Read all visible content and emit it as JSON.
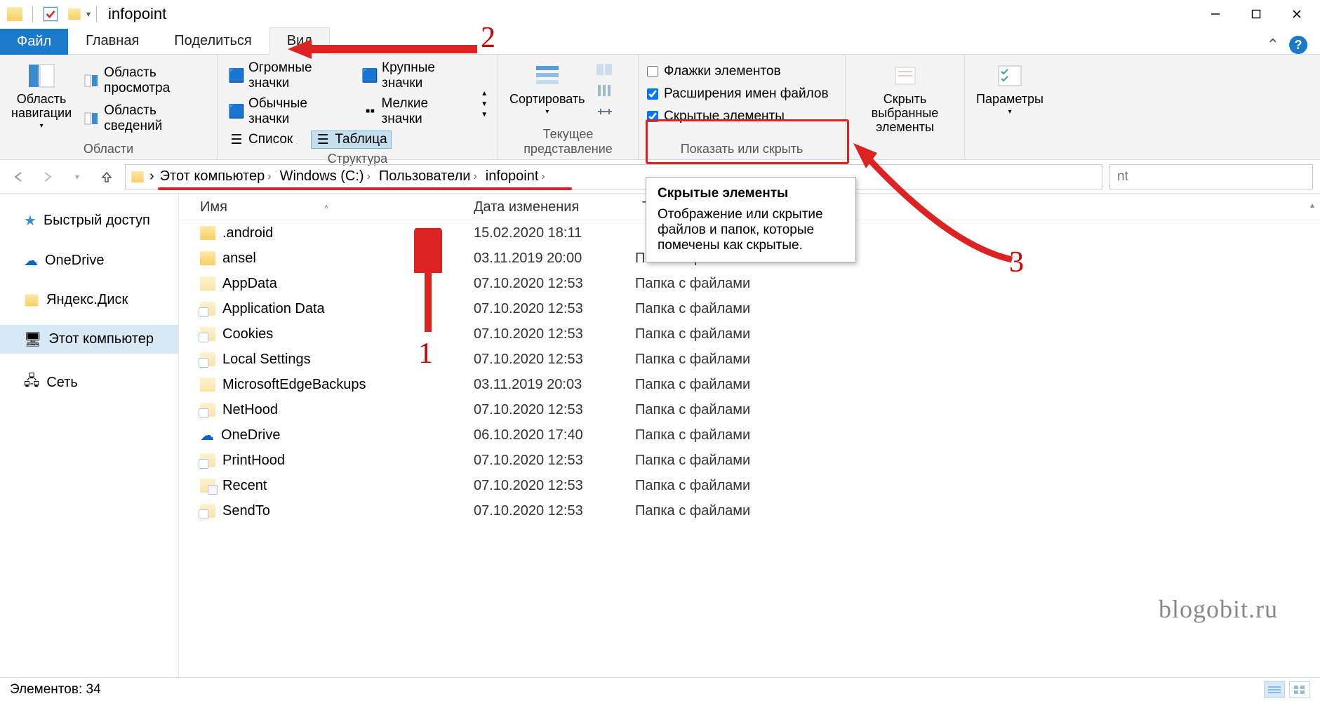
{
  "title": "infopoint",
  "tabs": {
    "file": "Файл",
    "home": "Главная",
    "share": "Поделиться",
    "view": "Вид"
  },
  "ribbon": {
    "panes": {
      "nav_pane": "Область\nнавигации",
      "preview": "Область просмотра",
      "details": "Область сведений",
      "group_panes": "Области"
    },
    "layout": {
      "huge": "Огромные значки",
      "large": "Крупные значки",
      "medium": "Обычные значки",
      "small": "Мелкие значки",
      "list": "Список",
      "table": "Таблица",
      "group_layout": "Структура"
    },
    "current_view": {
      "sort": "Сортировать",
      "group_view": "Текущее представление"
    },
    "show_hide": {
      "item_check": "Флажки элементов",
      "extensions": "Расширения имен файлов",
      "hidden": "Скрытые элементы",
      "group_show": "Показать или скрыть"
    },
    "hide_selected": "Скрыть выбранные\nэлементы",
    "options": "Параметры"
  },
  "breadcrumb": [
    "Этот компьютер",
    "Windows (C:)",
    "Пользователи",
    "infopoint"
  ],
  "search_hint": "nt",
  "columns": {
    "name": "Имя",
    "date": "Дата изменения",
    "type": "Тип"
  },
  "sidebar": {
    "quick": "Быстрый доступ",
    "onedrive": "OneDrive",
    "yadisk": "Яндекс.Диск",
    "thispc": "Этот компьютер",
    "network": "Сеть"
  },
  "rows": [
    {
      "name": ".android",
      "date": "15.02.2020 18:11",
      "type": "",
      "icon": "folder"
    },
    {
      "name": "ansel",
      "date": "03.11.2019 20:00",
      "type": "Папка с файлами",
      "icon": "folder"
    },
    {
      "name": "AppData",
      "date": "07.10.2020 12:53",
      "type": "Папка с файлами",
      "icon": "folder-faded"
    },
    {
      "name": "Application Data",
      "date": "07.10.2020 12:53",
      "type": "Папка с файлами",
      "icon": "folder-link"
    },
    {
      "name": "Cookies",
      "date": "07.10.2020 12:53",
      "type": "Папка с файлами",
      "icon": "folder-link"
    },
    {
      "name": "Local Settings",
      "date": "07.10.2020 12:53",
      "type": "Папка с файлами",
      "icon": "folder-link"
    },
    {
      "name": "MicrosoftEdgeBackups",
      "date": "03.11.2019 20:03",
      "type": "Папка с файлами",
      "icon": "folder-faded"
    },
    {
      "name": "NetHood",
      "date": "07.10.2020 12:53",
      "type": "Папка с файлами",
      "icon": "folder-link"
    },
    {
      "name": "OneDrive",
      "date": "06.10.2020 17:40",
      "type": "Папка с файлами",
      "icon": "folder-cloud"
    },
    {
      "name": "PrintHood",
      "date": "07.10.2020 12:53",
      "type": "Папка с файлами",
      "icon": "folder-link"
    },
    {
      "name": "Recent",
      "date": "07.10.2020 12:53",
      "type": "Папка с файлами",
      "icon": "folder-sys"
    },
    {
      "name": "SendTo",
      "date": "07.10.2020 12:53",
      "type": "Папка с файлами",
      "icon": "folder-link"
    }
  ],
  "tooltip": {
    "title": "Скрытые элементы",
    "body": "Отображение или скрытие файлов и папок, которые помечены как скрытые."
  },
  "status": "Элементов: 34",
  "watermark": "blogobit.ru",
  "annotations": {
    "a1": "1",
    "a2": "2",
    "a3": "3"
  }
}
